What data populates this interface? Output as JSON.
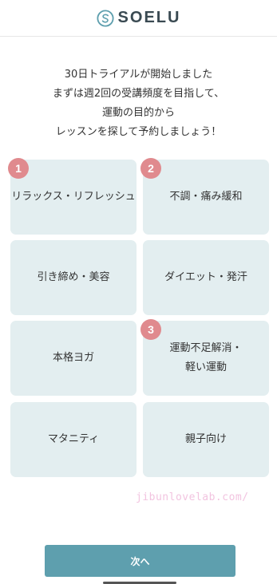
{
  "header": {
    "logo_text": "SOELU",
    "logo_icon": "soelu-s-logo-icon",
    "logo_color": "#5e9fae"
  },
  "intro": {
    "lines": [
      "30日トライアルが開始しました",
      "まずは週2回の受講頻度を目指して、",
      "運動の目的から",
      "レッスンを探して予約しましょう！"
    ]
  },
  "categories": [
    {
      "label_lines": [
        "リラックス・リフレッシュ"
      ],
      "badge": "1"
    },
    {
      "label_lines": [
        "不調・痛み緩和"
      ],
      "badge": "2"
    },
    {
      "label_lines": [
        "引き締め・美容"
      ],
      "badge": ""
    },
    {
      "label_lines": [
        "ダイエット・発汗"
      ],
      "badge": ""
    },
    {
      "label_lines": [
        "本格ヨガ"
      ],
      "badge": ""
    },
    {
      "label_lines": [
        "運動不足解消・",
        "軽い運動"
      ],
      "badge": "3"
    },
    {
      "label_lines": [
        "マタニティ"
      ],
      "badge": ""
    },
    {
      "label_lines": [
        "親子向け"
      ],
      "badge": ""
    }
  ],
  "watermark": "jibunlovelab.com/",
  "next_button_label": "次へ",
  "colors": {
    "card_bg": "#e3eef0",
    "badge_bg": "#e08a8e",
    "button_bg": "#5e9fae"
  }
}
